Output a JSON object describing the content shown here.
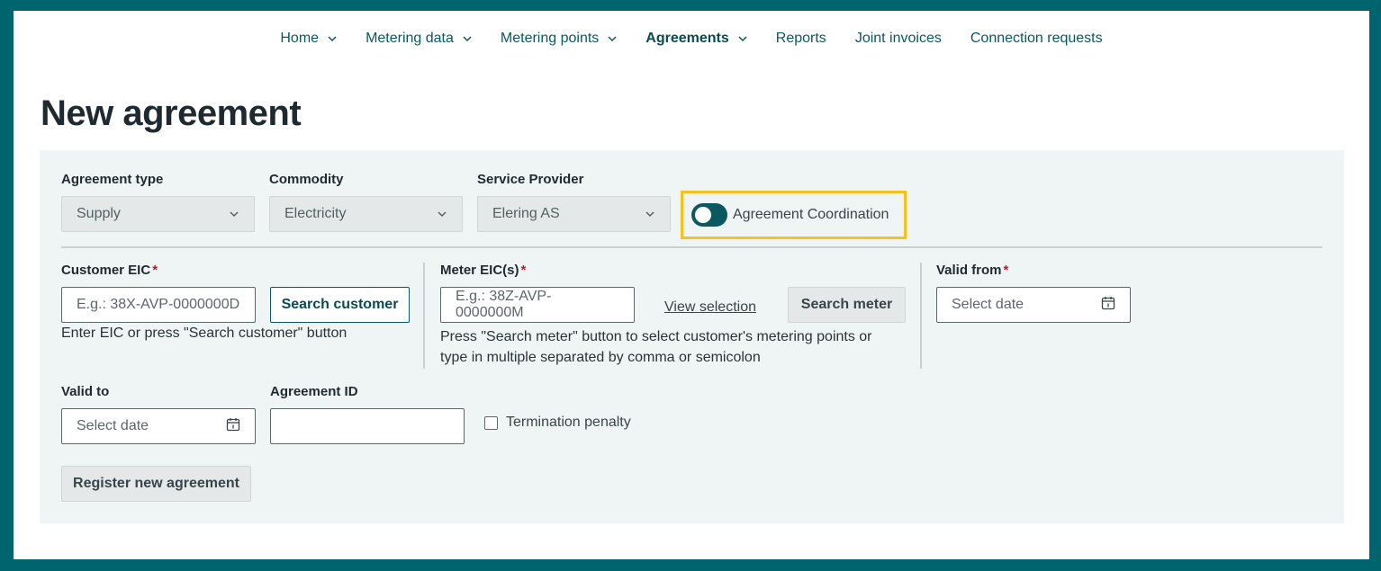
{
  "nav": {
    "items": [
      {
        "label": "Home",
        "dropdown": true,
        "active": false
      },
      {
        "label": "Metering data",
        "dropdown": true,
        "active": false
      },
      {
        "label": "Metering points",
        "dropdown": true,
        "active": false
      },
      {
        "label": "Agreements",
        "dropdown": true,
        "active": true
      },
      {
        "label": "Reports",
        "dropdown": false,
        "active": false
      },
      {
        "label": "Joint invoices",
        "dropdown": false,
        "active": false
      },
      {
        "label": "Connection requests",
        "dropdown": false,
        "active": false
      }
    ]
  },
  "page": {
    "title": "New agreement"
  },
  "form": {
    "agreement_type": {
      "label": "Agreement type",
      "value": "Supply"
    },
    "commodity": {
      "label": "Commodity",
      "value": "Electricity"
    },
    "service_provider": {
      "label": "Service Provider",
      "value": "Elering AS"
    },
    "coordination": {
      "label": "Agreement Coordination",
      "enabled": true
    },
    "customer_eic": {
      "label": "Customer EIC",
      "required_mark": "*",
      "placeholder": "E.g.: 38X-AVP-0000000D",
      "search_button": "Search customer",
      "help": "Enter EIC or press \"Search customer\" button"
    },
    "meter_eic": {
      "label": "Meter EIC(s)",
      "required_mark": "*",
      "placeholder": "E.g.: 38Z-AVP-0000000M",
      "view_selection": "View selection",
      "search_button": "Search meter",
      "help_line1": "Press \"Search meter\" button to select customer's metering points or",
      "help_line2": "type in multiple separated by comma or semicolon"
    },
    "valid_from": {
      "label": "Valid from",
      "required_mark": "*",
      "placeholder": "Select date"
    },
    "valid_to": {
      "label": "Valid to",
      "placeholder": "Select date"
    },
    "agreement_id": {
      "label": "Agreement ID",
      "value": ""
    },
    "termination_penalty": {
      "label": "Termination penalty",
      "checked": false
    },
    "submit_button": "Register new agreement"
  },
  "colors": {
    "frame": "#00646e",
    "accent": "#0b5860",
    "highlight": "#f4c21a",
    "required": "#c8102e"
  }
}
